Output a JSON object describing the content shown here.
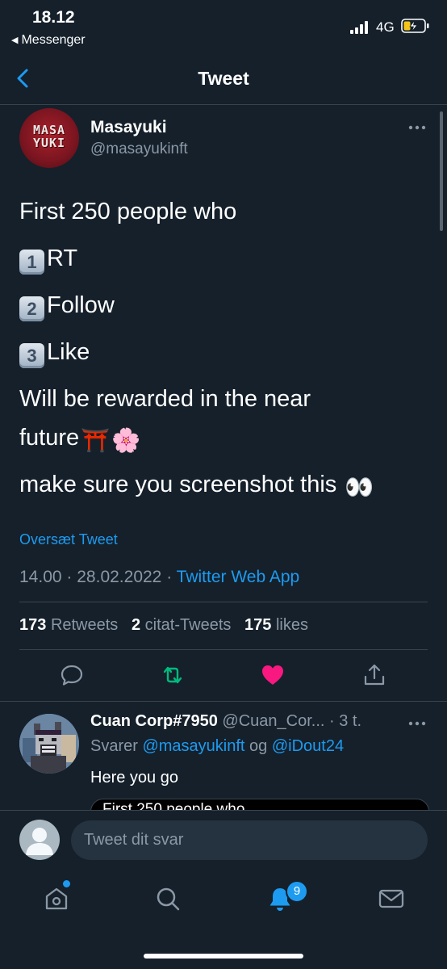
{
  "status_bar": {
    "time": "18.12",
    "back_app": "Messenger",
    "network": "4G",
    "icons": [
      "signal-bars-icon",
      "battery-charging-icon"
    ]
  },
  "header": {
    "title": "Tweet",
    "back_icon": "chevron-left-icon"
  },
  "tweet": {
    "author_name": "Masayuki",
    "author_handle": "@masayukinft",
    "avatar_logo_lines": [
      "MASA",
      "YUKI"
    ],
    "lines": {
      "intro": "First 250 people who",
      "step1": "RT",
      "step2": "Follow",
      "step3": "Like",
      "reward1": "Will be rewarded in the near",
      "reward2": "future",
      "screenshot": "make sure you screenshot this"
    },
    "keycaps": [
      "1",
      "2",
      "3"
    ],
    "emojis": [
      "⛩️",
      "🌸",
      "👀"
    ],
    "translate_label": "Oversæt Tweet",
    "time": "14.00",
    "date": "28.02.2022",
    "separator": "·",
    "source": "Twitter Web App",
    "stats": {
      "retweets_count": "173",
      "retweets_label": "Retweets",
      "quotes_count": "2",
      "quotes_label": "citat-Tweets",
      "likes_count": "175",
      "likes_label": "likes"
    },
    "actions": [
      "reply-icon",
      "retweet-icon",
      "like-icon",
      "share-icon"
    ],
    "colors": {
      "retweet": "#00ba7c",
      "like": "#f91880",
      "link": "#1d9bf0"
    }
  },
  "reply": {
    "name": "Cuan Corp#7950",
    "handle": "@Cuan_Cor...",
    "time": "· 3 t.",
    "replying_prefix": "Svarer",
    "mention1": "@masayukinft",
    "conjunction": "og",
    "mention2": "@iDout24",
    "text": "Here you go",
    "quote_preview": "First 250 people who"
  },
  "compose": {
    "placeholder": "Tweet dit svar"
  },
  "tab_bar": {
    "tabs": [
      "home-icon",
      "search-icon",
      "notifications-icon",
      "messages-icon"
    ],
    "notification_count": "9"
  }
}
